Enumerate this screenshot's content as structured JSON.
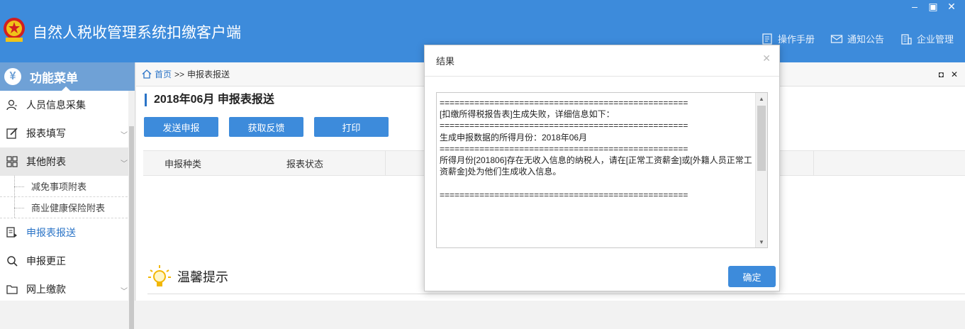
{
  "app": {
    "title": "自然人税收管理系统扣缴客户端",
    "accent": "#3d8bdb"
  },
  "header_links": [
    {
      "label": "操作手册",
      "icon": "manual-icon"
    },
    {
      "label": "通知公告",
      "icon": "mail-icon"
    },
    {
      "label": "企业管理",
      "icon": "building-icon"
    }
  ],
  "sidebar": {
    "title": "功能菜单",
    "items": [
      {
        "label": "人员信息采集",
        "icon": "person-icon"
      },
      {
        "label": "报表填写",
        "icon": "edit-icon"
      },
      {
        "label": "其他附表",
        "icon": "grid-icon"
      },
      {
        "label": "减免事项附表"
      },
      {
        "label": "商业健康保险附表"
      },
      {
        "label": "申报表报送",
        "icon": "report-send-icon"
      },
      {
        "label": "申报更正",
        "icon": "search-icon"
      },
      {
        "label": "网上缴款",
        "icon": "folder-icon"
      }
    ]
  },
  "breadcrumb": {
    "home": "首页",
    "sep": ">>",
    "current": "申报表报送"
  },
  "page": {
    "title": "2018年06月  申报表报送",
    "buttons": [
      "发送申报",
      "获取反馈",
      "打印"
    ],
    "columns": [
      "申报种类",
      "报表状态"
    ],
    "tip": "温馨提示"
  },
  "dialog": {
    "title": "结果",
    "text": "==================================================\n[扣缴所得税报告表]生成失败，详细信息如下：\n==================================================\n生成申报数据的所得月份：2018年06月\n==================================================\n所得月份[201806]存在无收入信息的纳税人，请在[正常工资薪金]或[外籍人员正常工资薪金]处为他们生成收入信息。\n\n==================================================",
    "ok": "确定"
  }
}
